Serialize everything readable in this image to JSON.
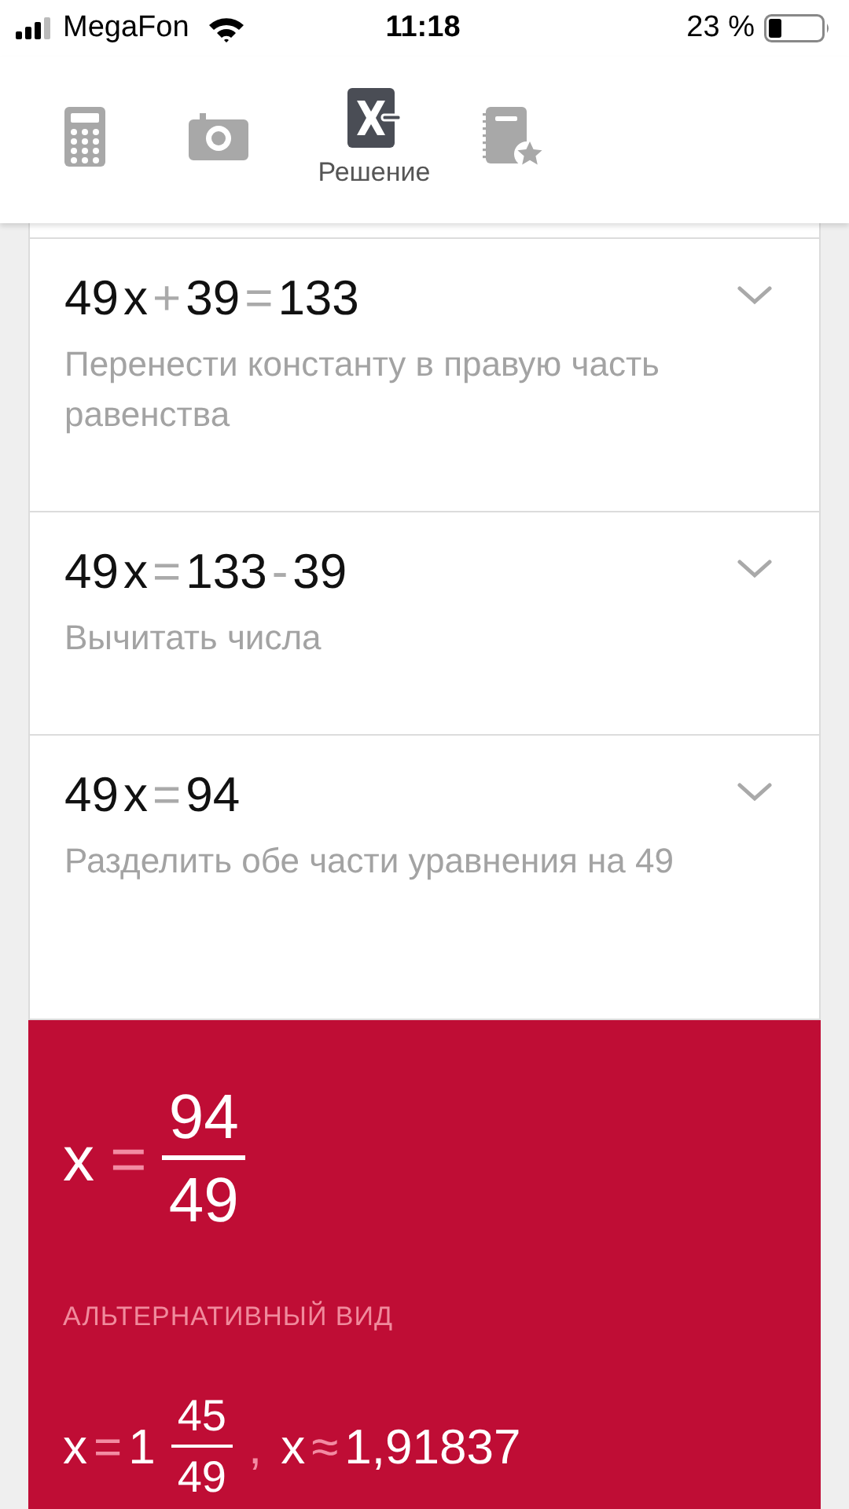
{
  "status_bar": {
    "carrier": "MegaFon",
    "time": "11:18",
    "battery": "23 %"
  },
  "tabs": [
    {
      "kind": "calculator",
      "selected": false
    },
    {
      "kind": "camera",
      "selected": false
    },
    {
      "kind": "solution",
      "label": "Решение",
      "selected": true
    },
    {
      "kind": "notebook",
      "selected": false
    }
  ],
  "steps": [
    {
      "equation": [
        {
          "text": "49",
          "kind": "term"
        },
        {
          "text": "x",
          "kind": "term"
        },
        {
          "text": "+",
          "kind": "op"
        },
        {
          "text": "39",
          "kind": "term"
        },
        {
          "text": "=",
          "kind": "op"
        },
        {
          "text": "133",
          "kind": "term"
        }
      ],
      "description": "Перенести константу в правую часть равенства"
    },
    {
      "equation": [
        {
          "text": "49",
          "kind": "term"
        },
        {
          "text": "x",
          "kind": "term"
        },
        {
          "text": "=",
          "kind": "op"
        },
        {
          "text": "133",
          "kind": "term"
        },
        {
          "text": "-",
          "kind": "op"
        },
        {
          "text": "39",
          "kind": "term"
        }
      ],
      "description": "Вычитать числа"
    },
    {
      "equation": [
        {
          "text": "49",
          "kind": "term"
        },
        {
          "text": "x",
          "kind": "term"
        },
        {
          "text": "=",
          "kind": "op"
        },
        {
          "text": "94",
          "kind": "term"
        }
      ],
      "description": "Разделить обе части уравнения на 49"
    }
  ],
  "result": {
    "variable": "x",
    "equals": "=",
    "numerator": "94",
    "denominator": "49",
    "alternative_label": "АЛЬТЕРНАТИВНЫЙ ВИД",
    "alternative": {
      "variable": "x",
      "equals": "=",
      "whole": "1",
      "numerator": "45",
      "denominator": "49",
      "separator": ",",
      "variable_2": "x",
      "approx": "≈",
      "decimal": "1,91837"
    }
  }
}
